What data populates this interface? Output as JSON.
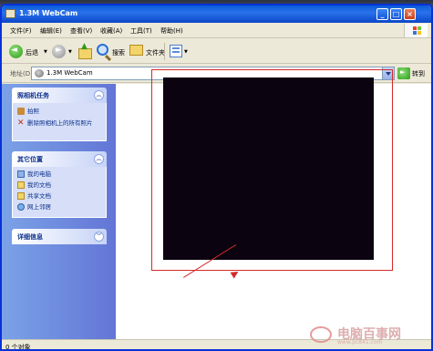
{
  "window": {
    "title": "1.3M WebCam"
  },
  "menu": {
    "items": [
      "文件(F)",
      "编辑(E)",
      "查看(V)",
      "收藏(A)",
      "工具(T)",
      "帮助(H)"
    ]
  },
  "toolbar": {
    "back_label": "后退",
    "search_label": "搜索",
    "folders_label": "文件夹"
  },
  "address": {
    "label": "地址(D)",
    "value": "1.3M WebCam",
    "go_label": "转到"
  },
  "taskpane": {
    "camera_tasks": {
      "title": "照相机任务",
      "items": [
        "拍照",
        "删除照相机上的所有照片"
      ]
    },
    "other_places": {
      "title": "其它位置",
      "items": [
        "我的电脑",
        "我的文档",
        "共享文档",
        "网上邻居"
      ]
    },
    "details": {
      "title": "详细信息"
    }
  },
  "status": {
    "text": "0 个对象"
  },
  "watermark": {
    "text": "电脑百事网",
    "url": "www.pc841.com"
  },
  "colors": {
    "titlebar": "#0a5bd9",
    "taskpane": "#7ba2e7",
    "highlight": "#d42a2a"
  }
}
